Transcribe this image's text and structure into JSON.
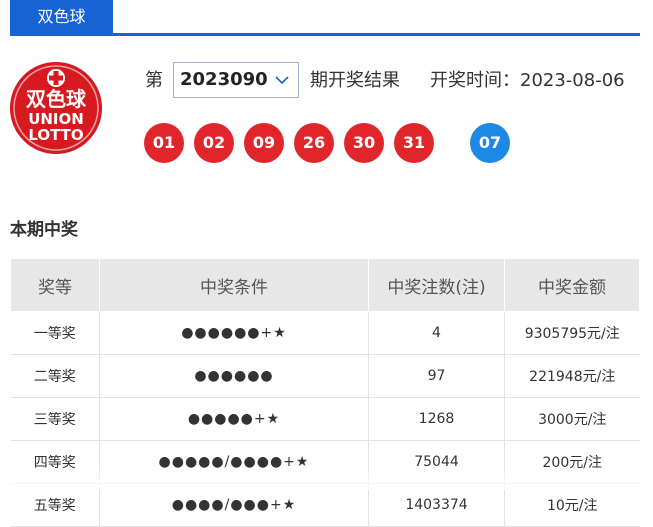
{
  "tab": {
    "label": "双色球"
  },
  "logo": {
    "top_text": "双色球",
    "brand_line1": "UNION",
    "brand_line2": "LOTTO"
  },
  "issue": {
    "prefix": "第",
    "value": "2023090",
    "suffix": "期开奖结果"
  },
  "draw_time": {
    "label": "开奖时间：",
    "value": "2023-08-06"
  },
  "balls": {
    "red": [
      "01",
      "02",
      "09",
      "26",
      "30",
      "31"
    ],
    "blue": [
      "07"
    ],
    "colors": {
      "red": "#e0262b",
      "blue": "#1e88e5"
    }
  },
  "section": {
    "title": "本期中奖"
  },
  "table": {
    "headers": [
      "奖等",
      "中奖条件",
      "中奖注数(注)",
      "中奖金额"
    ],
    "rows": [
      {
        "level": "一等奖",
        "condition": "●●●●●●+★",
        "count": "4",
        "amount": "9305795元/注"
      },
      {
        "level": "二等奖",
        "condition": "●●●●●●",
        "count": "97",
        "amount": "221948元/注"
      },
      {
        "level": "三等奖",
        "condition": "●●●●●+★",
        "count": "1268",
        "amount": "3000元/注"
      },
      {
        "level": "四等奖",
        "condition": "●●●●●/●●●●+★",
        "count": "75044",
        "amount": "200元/注"
      },
      {
        "level": "五等奖",
        "condition": "●●●●/●●●+★",
        "count": "1403374",
        "amount": "10元/注"
      }
    ]
  },
  "brand_color": "#1763d4"
}
